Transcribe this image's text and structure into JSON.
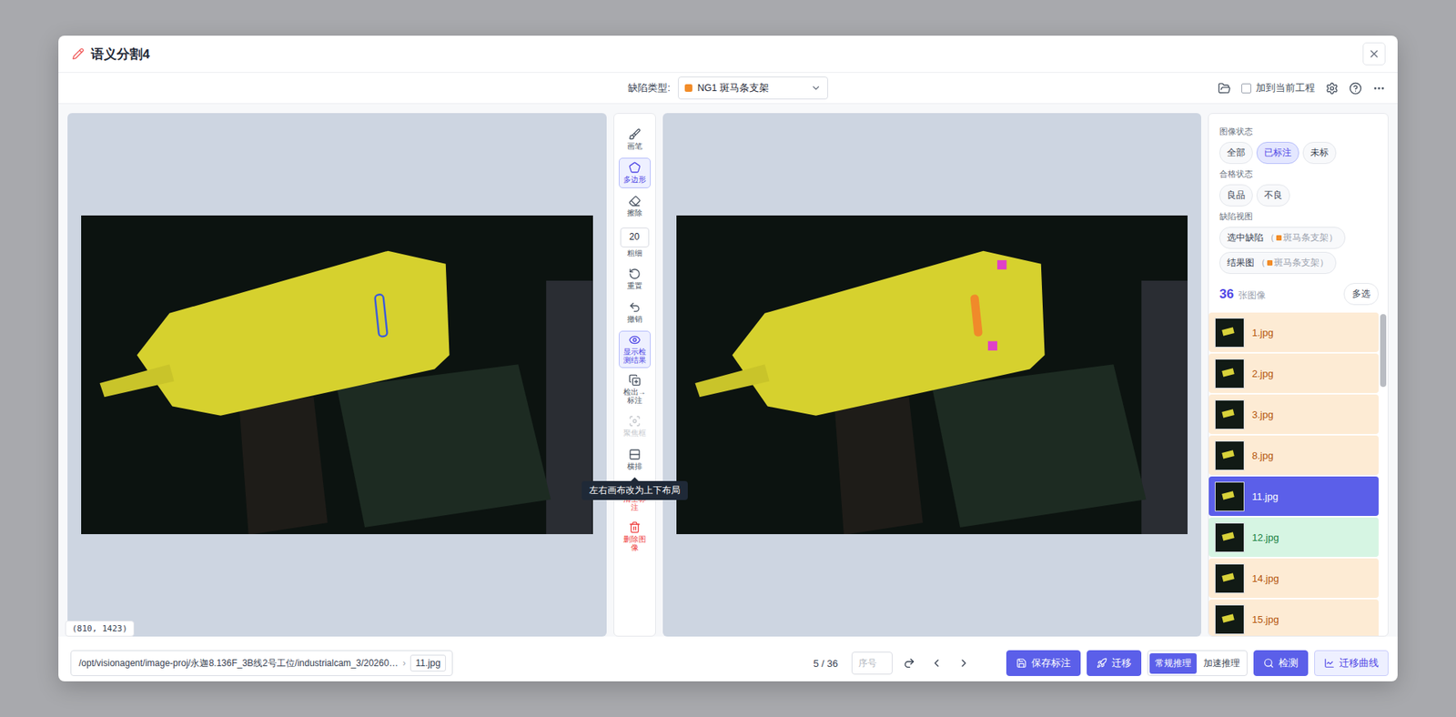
{
  "dialog": {
    "title": "语义分割4"
  },
  "toolbar": {
    "defect_label": "缺陷类型:",
    "defect_value": "NG1 斑马条支架",
    "defect_color": "#f28c28",
    "add_to_project": {
      "label": "加到当前工程",
      "checked": false
    }
  },
  "tools": [
    {
      "label": "画笔",
      "kind": "button",
      "selected": false,
      "disabled": false,
      "danger": false
    },
    {
      "label": "多边形",
      "kind": "button",
      "selected": true,
      "disabled": false,
      "danger": false
    },
    {
      "label": "擦除",
      "kind": "button",
      "selected": false,
      "disabled": false,
      "danger": false
    },
    {
      "label": "粗细",
      "kind": "number",
      "value": "20",
      "selected": false,
      "disabled": false,
      "danger": false
    },
    {
      "label": "重置",
      "kind": "button",
      "selected": false,
      "disabled": false,
      "danger": false
    },
    {
      "label": "撤销",
      "kind": "button",
      "selected": false,
      "disabled": false,
      "danger": false
    },
    {
      "label": "显示检测结果",
      "kind": "button",
      "selected": true,
      "disabled": false,
      "danger": false
    },
    {
      "label": "检出→标注",
      "kind": "button",
      "selected": false,
      "disabled": false,
      "danger": false
    },
    {
      "label": "聚焦框",
      "kind": "button",
      "selected": false,
      "disabled": true,
      "danger": false
    },
    {
      "label": "横排",
      "kind": "button",
      "selected": false,
      "disabled": false,
      "danger": false,
      "tooltip": "左右画布改为上下布局"
    },
    {
      "label": "清空标注",
      "kind": "button",
      "selected": false,
      "disabled": false,
      "danger": true
    },
    {
      "label": "删除图像",
      "kind": "button",
      "selected": false,
      "disabled": false,
      "danger": true
    }
  ],
  "canvas": {
    "coords": "(810, 1423)"
  },
  "filters": {
    "image_status": {
      "label": "图像状态",
      "options": [
        {
          "label": "全部",
          "selected": false
        },
        {
          "label": "已标注",
          "selected": true
        },
        {
          "label": "未标",
          "selected": false
        }
      ]
    },
    "quality": {
      "label": "合格状态",
      "options": [
        {
          "label": "良品",
          "selected": false
        },
        {
          "label": "不良",
          "selected": false
        }
      ]
    },
    "defect_view": {
      "label": "缺陷视图",
      "options": [
        {
          "label": "选中缺陷",
          "open": "（",
          "tag": "斑马条支架",
          "close": "）",
          "color": "#f28c28"
        },
        {
          "label": "结果图",
          "open": "（",
          "tag": "斑马条支架",
          "close": "）",
          "color": "#f28c28"
        }
      ]
    }
  },
  "images": {
    "count": "36",
    "unit": "张图像",
    "multi": "多选",
    "items": [
      {
        "name": "1.jpg",
        "selected": false,
        "good": false
      },
      {
        "name": "2.jpg",
        "selected": false,
        "good": false
      },
      {
        "name": "3.jpg",
        "selected": false,
        "good": false
      },
      {
        "name": "8.jpg",
        "selected": false,
        "good": false
      },
      {
        "name": "11.jpg",
        "selected": true,
        "good": false
      },
      {
        "name": "12.jpg",
        "selected": false,
        "good": true
      },
      {
        "name": "14.jpg",
        "selected": false,
        "good": false
      },
      {
        "name": "15.jpg",
        "selected": false,
        "good": false
      }
    ]
  },
  "footer": {
    "path": "/opt/visionagent/image-proj/永迦8.136F_3B线2号工位/industrialcam_3/20260…",
    "separator": "›",
    "file": "11.jpg",
    "position": "5 / 36",
    "index_placeholder": "序号",
    "save": "保存标注",
    "migrate": "迁移",
    "modes": [
      {
        "label": "常规推理",
        "selected": true
      },
      {
        "label": "加速推理",
        "selected": false
      }
    ],
    "detect": "检测",
    "curve": "迁移曲线"
  }
}
